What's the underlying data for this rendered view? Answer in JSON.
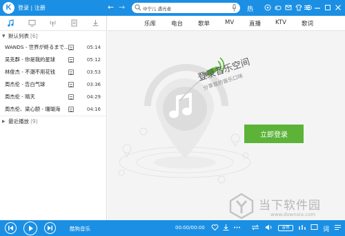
{
  "app": {
    "logo_letter": "K",
    "login_text": "登录 | 注册",
    "brand_color": "#1b8fe3"
  },
  "search": {
    "value": "中宁儿 遇光者",
    "placeholder": ""
  },
  "top_icons": [
    "back-arrow-icon",
    "forward-arrow-icon",
    "search-icon",
    "mic-icon",
    "hot-icon",
    "download-icon",
    "game-icon",
    "skin-icon",
    "shirt-icon",
    "settings-icon",
    "menu-icon",
    "minimize-icon",
    "maximize-icon",
    "close-icon"
  ],
  "hot_label": "热",
  "left_tabs": [
    "music-note-icon",
    "monitor-icon",
    "radio-icon",
    "document-icon",
    "download-icon"
  ],
  "playlist": {
    "default_label": "默认列表",
    "default_count": "[6]",
    "songs": [
      {
        "title": "WANDS - 世界が終るまで…",
        "duration": "05:14"
      },
      {
        "title": "吴克群 - 你是我的星球",
        "duration": "05:12"
      },
      {
        "title": "林俊杰 - 不潮不用花钱",
        "duration": "03:53"
      },
      {
        "title": "周杰伦 - 告白气球",
        "duration": "03:36"
      },
      {
        "title": "周杰伦 - 晴天",
        "duration": "04:29"
      },
      {
        "title": "周杰伦、梁心颐 - 珊瑚海",
        "duration": "04:16"
      }
    ],
    "recent_label": "最近播放",
    "recent_count": "(9)"
  },
  "main_tabs": [
    "乐库",
    "电台",
    "歌单",
    "MV",
    "直播",
    "KTV",
    "歌词"
  ],
  "promo": {
    "title": "登录音乐空间",
    "subtitle": "分享我的音乐口味",
    "login_button": "立即登录",
    "accent_green": "#5cb338"
  },
  "player": {
    "now_playing": "酷狗音乐",
    "time": "00:00/00:00",
    "sound_label": "音效",
    "lyrics_label": "词"
  },
  "watermark": {
    "name": "当下软件园",
    "url": "www.downxia.com"
  }
}
